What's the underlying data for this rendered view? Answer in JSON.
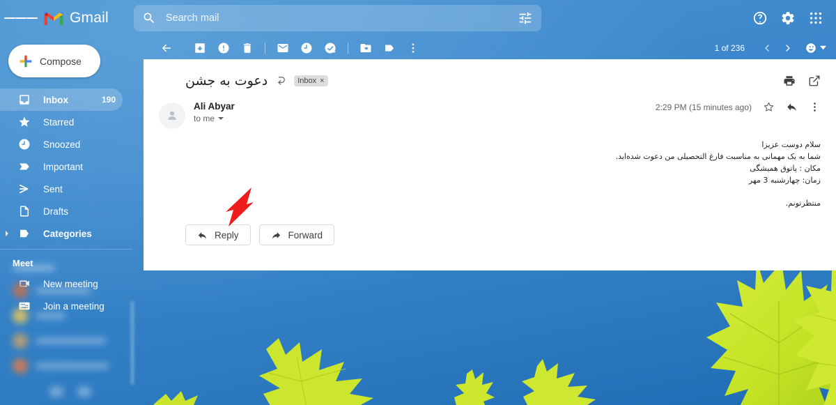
{
  "header": {
    "menu_icon": "hamburger-icon",
    "logo_icon": "gmail-logo-icon",
    "app_name": "Gmail",
    "search": {
      "icon": "search-icon",
      "placeholder": "Search mail",
      "value": "",
      "options_icon": "search-options-icon"
    },
    "right_icons": [
      {
        "name": "help-icon",
        "label": "Support"
      },
      {
        "name": "gear-icon",
        "label": "Settings"
      },
      {
        "name": "apps-grid-icon",
        "label": "Google apps"
      }
    ]
  },
  "sidebar": {
    "compose": {
      "label": "Compose",
      "icon": "plus-icon"
    },
    "items": [
      {
        "label": "Inbox",
        "icon": "inbox-icon",
        "count": "190",
        "active": true
      },
      {
        "label": "Starred",
        "icon": "star-icon",
        "count": "",
        "active": false
      },
      {
        "label": "Snoozed",
        "icon": "clock-icon",
        "count": "",
        "active": false
      },
      {
        "label": "Important",
        "icon": "important-marker-icon",
        "count": "",
        "active": false
      },
      {
        "label": "Sent",
        "icon": "send-icon",
        "count": "",
        "active": false
      },
      {
        "label": "Drafts",
        "icon": "draft-icon",
        "count": "",
        "active": false
      },
      {
        "label": "Categories",
        "icon": "label-icon",
        "count": "",
        "active": false,
        "expandable": true
      }
    ],
    "meet": {
      "title": "Meet",
      "items": [
        {
          "label": "New meeting",
          "icon": "video-camera-icon"
        },
        {
          "label": "Join a meeting",
          "icon": "keyboard-icon"
        }
      ]
    }
  },
  "toolbar": {
    "back_icon": "back-arrow-icon",
    "buttons": [
      {
        "name": "archive-icon",
        "label": "Archive"
      },
      {
        "name": "report-spam-icon",
        "label": "Report spam"
      },
      {
        "name": "delete-icon",
        "label": "Delete"
      },
      {
        "name": "mark-unread-icon",
        "label": "Mark as unread"
      },
      {
        "name": "snooze-icon",
        "label": "Snooze"
      },
      {
        "name": "add-to-tasks-icon",
        "label": "Add to Tasks"
      },
      {
        "name": "move-to-icon",
        "label": "Move to"
      },
      {
        "name": "labels-icon",
        "label": "Labels"
      },
      {
        "name": "more-options-icon",
        "label": "More"
      }
    ],
    "pager": "1 of 236",
    "prev_icon": "chevron-left-icon",
    "next_icon": "chevron-right-icon",
    "input_tools_icon": "input-tools-icon",
    "input_tools_caret": "chevron-down-icon"
  },
  "message": {
    "subject": "دعوت به جشن",
    "subject_icon": "print-preview-icon",
    "label_chip": {
      "text": "Inbox",
      "remove": "×"
    },
    "print_icon": "print-icon",
    "popout_icon": "open-in-new-window-icon",
    "sender": {
      "name": "Ali Abyar",
      "recipient": "to me",
      "avatar_icon": "person-avatar-icon"
    },
    "time": "2:29 PM (15 minutes ago)",
    "meta_icons": [
      {
        "name": "star-outline-icon",
        "label": "Star"
      },
      {
        "name": "reply-icon",
        "label": "Reply"
      },
      {
        "name": "more-vertical-icon",
        "label": "More"
      }
    ],
    "body_lines": [
      "سلام دوست عزیزا",
      "شما به یک مهمانی به مناسبت فارغ التحصیلی من دعوت شده‌اید.",
      "مکان : پاتوق همیشگی",
      "زمان: چهارشنبه 3 مهر"
    ],
    "body_closing": "منتظرتونم.",
    "actions": [
      {
        "label": "Reply",
        "icon": "reply-arrow-icon"
      },
      {
        "label": "Forward",
        "icon": "forward-arrow-icon"
      }
    ]
  },
  "annotation": {
    "arrow_icon": "red-pointer-arrow",
    "color": "#ee1c1c",
    "points_at": "Reply"
  },
  "colors": {
    "header_blue": "#2f7fc4",
    "sky_blue": "#3a87ce",
    "leaf_green": "#c8e526",
    "panel_white": "#ffffff",
    "accent_red": "#ee1c1c"
  }
}
